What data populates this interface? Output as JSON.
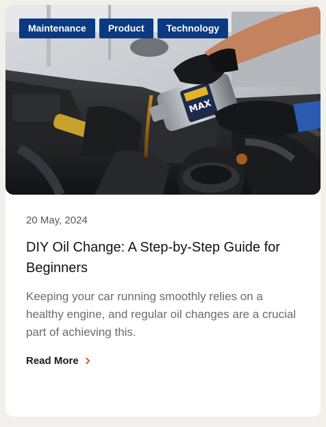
{
  "tags": [
    "Maintenance",
    "Product",
    "Technology"
  ],
  "post": {
    "date": "20 May, 2024",
    "title": "DIY Oil Change: A Step-by-Step Guide for Beginners",
    "excerpt": "Keeping your car running smoothly relies on a healthy engine, and regular oil changes are a crucial part of achieving this.",
    "read_more": "Read More"
  },
  "hero": {
    "label_text": "MAX",
    "icon": "oil-change-photo"
  },
  "colors": {
    "tag_bg": "#0b3a82",
    "accent": "#d9503a",
    "page_bg": "#f2f0eb"
  }
}
